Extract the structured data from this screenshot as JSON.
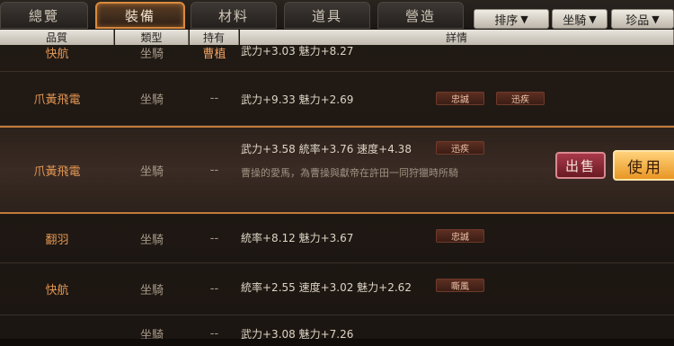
{
  "tabs": [
    {
      "label": "總覽"
    },
    {
      "label": "裝備"
    },
    {
      "label": "材料"
    },
    {
      "label": "道具"
    },
    {
      "label": "營造"
    }
  ],
  "sort_buttons": [
    {
      "label": "排序"
    },
    {
      "label": "坐騎"
    },
    {
      "label": "珍品"
    }
  ],
  "columns": {
    "quality": "品質",
    "type": "類型",
    "owner": "持有",
    "detail": "詳情"
  },
  "rows": [
    {
      "name": "快航",
      "type": "坐騎",
      "owner": "曹植",
      "stats": "武力+3.03 魅力+8.27",
      "tags": []
    },
    {
      "name": "爪黃飛電",
      "type": "坐騎",
      "owner": "--",
      "stats": "武力+9.33 魅力+2.69",
      "tags": [
        "忠誠",
        "迅疾"
      ]
    },
    {
      "name": "爪黃飛電",
      "type": "坐騎",
      "owner": "--",
      "stats": "武力+3.58 統率+3.76 速度+4.38",
      "tags": [
        "迅疾"
      ],
      "desc": "曹操的愛馬，為曹操與獻帝在許田一同狩獵時所騎"
    },
    {
      "name": "翻羽",
      "type": "坐騎",
      "owner": "--",
      "stats": "統率+8.12 魅力+3.67",
      "tags": [
        "忠誠"
      ]
    },
    {
      "name": "快航",
      "type": "坐騎",
      "owner": "--",
      "stats": "統率+2.55 速度+3.02 魅力+2.62",
      "tags": [
        "嘶風"
      ]
    },
    {
      "name": "",
      "type": "坐騎",
      "owner": "--",
      "stats": "武力+3.08 魅力+7.26",
      "tags": []
    }
  ],
  "actions": {
    "sell": "出售",
    "use": "使用"
  }
}
